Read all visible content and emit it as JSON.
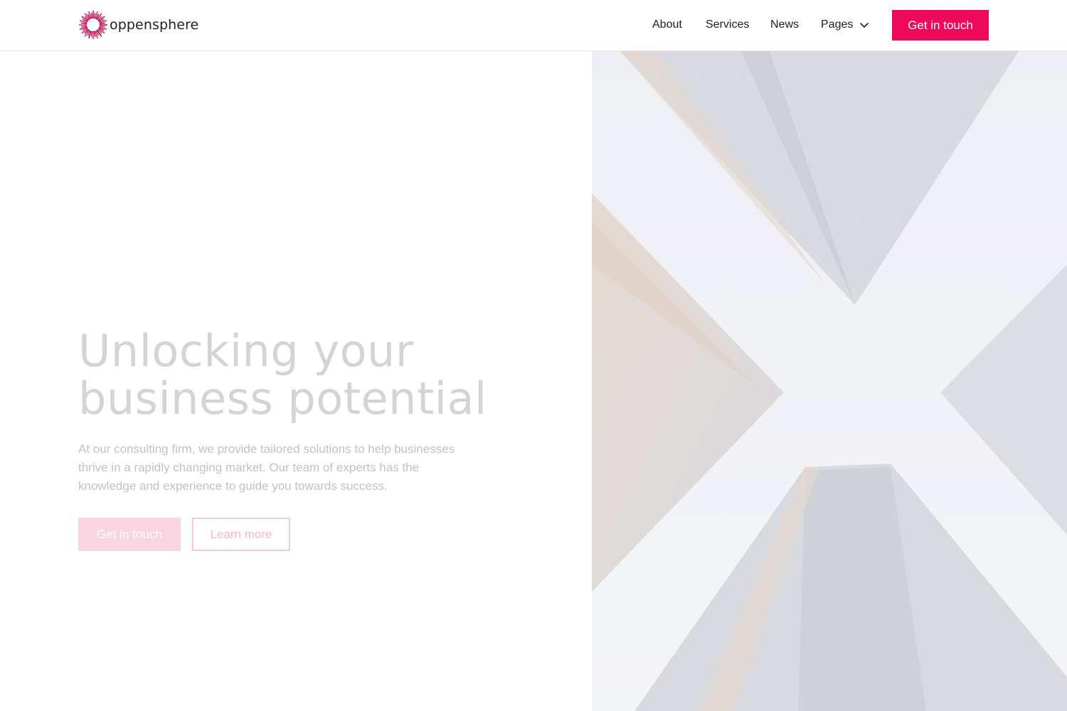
{
  "brand": {
    "name": "oppensphere",
    "logo_icon": "sunburst-logo-icon",
    "accent_color": "#ee0a5a"
  },
  "nav": {
    "items": [
      {
        "label": "About"
      },
      {
        "label": "Services"
      },
      {
        "label": "News"
      },
      {
        "label": "Pages",
        "icon": "chevron-down-icon"
      }
    ],
    "cta_label": "Get in touch"
  },
  "hero": {
    "title_line1": "Unlocking your",
    "title_line2": "business potential",
    "body": "At our consulting firm, we provide tailored solutions to help businesses thrive in a rapidly changing market. Our team of experts has the knowledge and experience to guide you towards success.",
    "primary_button": "Get in touch",
    "secondary_button": "Learn more",
    "image": "skyscrapers-looking-up-photo"
  }
}
